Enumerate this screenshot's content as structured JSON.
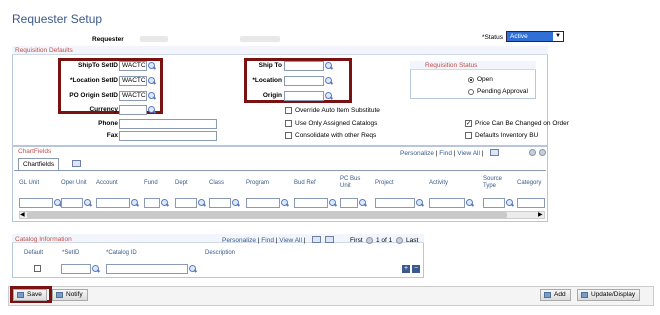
{
  "page_title": "Requester Setup",
  "header": {
    "requester_label": "Requester",
    "status_label": "*Status",
    "status_value": "Active"
  },
  "req_defaults": {
    "title": "Requisition Defaults",
    "shipto_setid_label": "ShipTo SetID",
    "shipto_setid_value": "WACTC",
    "location_setid_label": "*Location SetID",
    "location_setid_value": "WACTC",
    "po_origin_setid_label": "PO Origin SetID",
    "po_origin_setid_value": "WACTC",
    "currency_label": "Currency",
    "ship_to_label": "Ship To",
    "location_label": "*Location",
    "origin_label": "Origin",
    "phone_label": "Phone",
    "fax_label": "Fax",
    "override_label": "Override Auto Item Substitute",
    "use_assigned_label": "Use Only Assigned Catalogs",
    "consolidate_label": "Consolidate with other Reqs",
    "price_change_label": "Price Can Be Changed on Order",
    "defaults_inventory_label": "Defaults Inventory BU",
    "price_change_checked": "✓"
  },
  "req_status": {
    "title": "Requisition Status",
    "open_label": "Open",
    "pending_label": "Pending Approval",
    "selected": "open"
  },
  "chartfields": {
    "title": "ChartFields",
    "tab_label": "Chartfields",
    "nav": {
      "personalize": "Personalize",
      "sep1": "|",
      "find": "Find",
      "sep2": "|",
      "view_all": "View All",
      "sep3": "|"
    },
    "columns": [
      "GL Unit",
      "Oper Unit",
      "Account",
      "Fund",
      "Dept",
      "Class",
      "Program",
      "Bud Ref",
      "PC Bus Unit",
      "Project",
      "Activity",
      "Source Type",
      "Category"
    ]
  },
  "catalog": {
    "title": "Catalog Information",
    "nav": {
      "personalize": "Personalize",
      "sep1": "|",
      "find": "Find",
      "sep2": "|",
      "view_all": "View All",
      "sep3": "|",
      "first": "First",
      "range": "1 of 1",
      "last": "Last"
    },
    "col_default": "Default",
    "col_setid": "*SetID",
    "col_catalog_id": "*Catalog ID",
    "col_description": "Description"
  },
  "buttons": {
    "save": "Save",
    "notify": "Notify",
    "add": "Add",
    "update_display": "Update/Display"
  }
}
